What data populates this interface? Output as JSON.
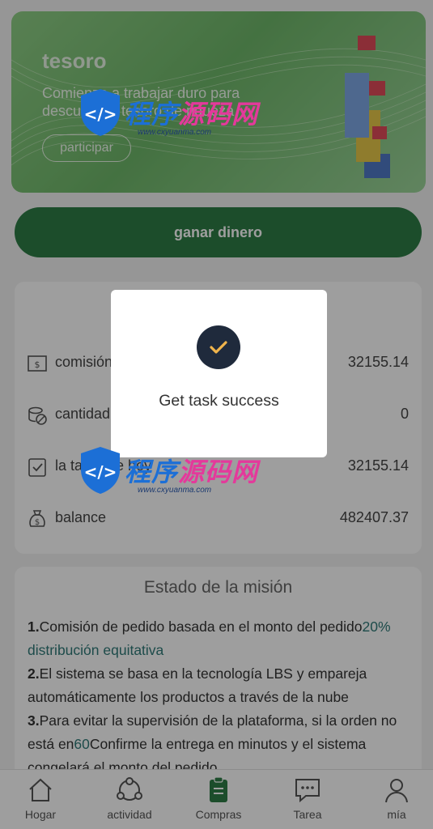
{
  "banner": {
    "title": "tesoro",
    "text": "Comienza a trabajar duro para descubrir el tesoro de riqueza",
    "button": "participar"
  },
  "action": {
    "label": "ganar dinero"
  },
  "stats": [
    {
      "icon": "money-bill-icon",
      "label": "comisión",
      "value": "32155.14"
    },
    {
      "icon": "coins-icon",
      "label": "cantidad",
      "value": "0"
    },
    {
      "icon": "checklist-icon",
      "label": "la tarea de hoy",
      "value": "32155.14"
    },
    {
      "icon": "money-bag-icon",
      "label": "balance",
      "value": "482407.37"
    }
  ],
  "mission": {
    "title": "Estado de la misión",
    "items": [
      {
        "num": "1.",
        "pre": "Comisión de pedido basada en el monto del pedido",
        "hl": "20% distribución equitativa",
        "post": ""
      },
      {
        "num": "2.",
        "pre": "El sistema se basa en la tecnología LBS y empareja automáticamente los productos a través de la nube",
        "hl": "",
        "post": ""
      },
      {
        "num": "3.",
        "pre": "Para evitar la supervisión de la plataforma, si la orden no está en",
        "hl": "60",
        "post": "Confirme la entrega en minutos y el sistema congelará el monto del pedido"
      }
    ]
  },
  "tabs": [
    {
      "icon": "home-icon",
      "label": "Hogar"
    },
    {
      "icon": "activity-icon",
      "label": "actividad"
    },
    {
      "icon": "clipboard-icon",
      "label": "Compras"
    },
    {
      "icon": "chat-icon",
      "label": "Tarea"
    },
    {
      "icon": "user-icon",
      "label": "mía"
    }
  ],
  "modal": {
    "message": "Get task success"
  },
  "watermark": {
    "text_a": "程序",
    "text_b": "源码网",
    "url": "www.cxyuanma.com"
  }
}
